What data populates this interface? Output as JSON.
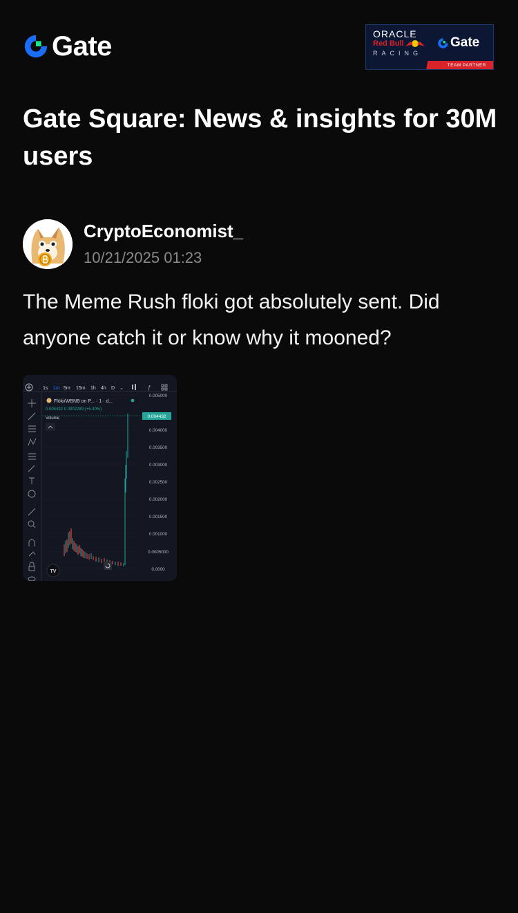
{
  "brand": {
    "name": "Gate",
    "icon": "gate-logo-icon",
    "color": "#1a6df5",
    "accent": "#17e68b"
  },
  "partner_badge": {
    "line1": "ORACLE",
    "line2": "Red Bull",
    "line3": "RACING",
    "gate": "Gate",
    "footer": "TEAM PARTNER"
  },
  "headline": "Gate Square: News & insights for 30M users",
  "post": {
    "author": "CryptoEconomist_",
    "avatar_icon": "shiba-coin-avatar-icon",
    "timestamp": "10/21/2025 01:23",
    "text": "The Meme Rush floki got absolutely sent. Did anyone catch it or know why it mooned?"
  },
  "chart_image": {
    "timeframes": [
      "1s",
      "1m",
      "5m",
      "15m",
      "1h",
      "4h",
      "D"
    ],
    "active_timeframe": "1m",
    "pair": "Flöki/WBNB on P... · 1 · d...",
    "quote": "0.004432  0.0002289 (+5.40%)",
    "volume_label": "Volume",
    "price_tag": "0.004432",
    "y_ticks": [
      "0.005000",
      "0.004000",
      "0.003500",
      "0.003000",
      "0.002500",
      "0.002000",
      "0.001500",
      "0.001000",
      "0.0005000",
      "0.0000"
    ],
    "up_color": "#26a69a",
    "down_color": "#ef5350"
  }
}
